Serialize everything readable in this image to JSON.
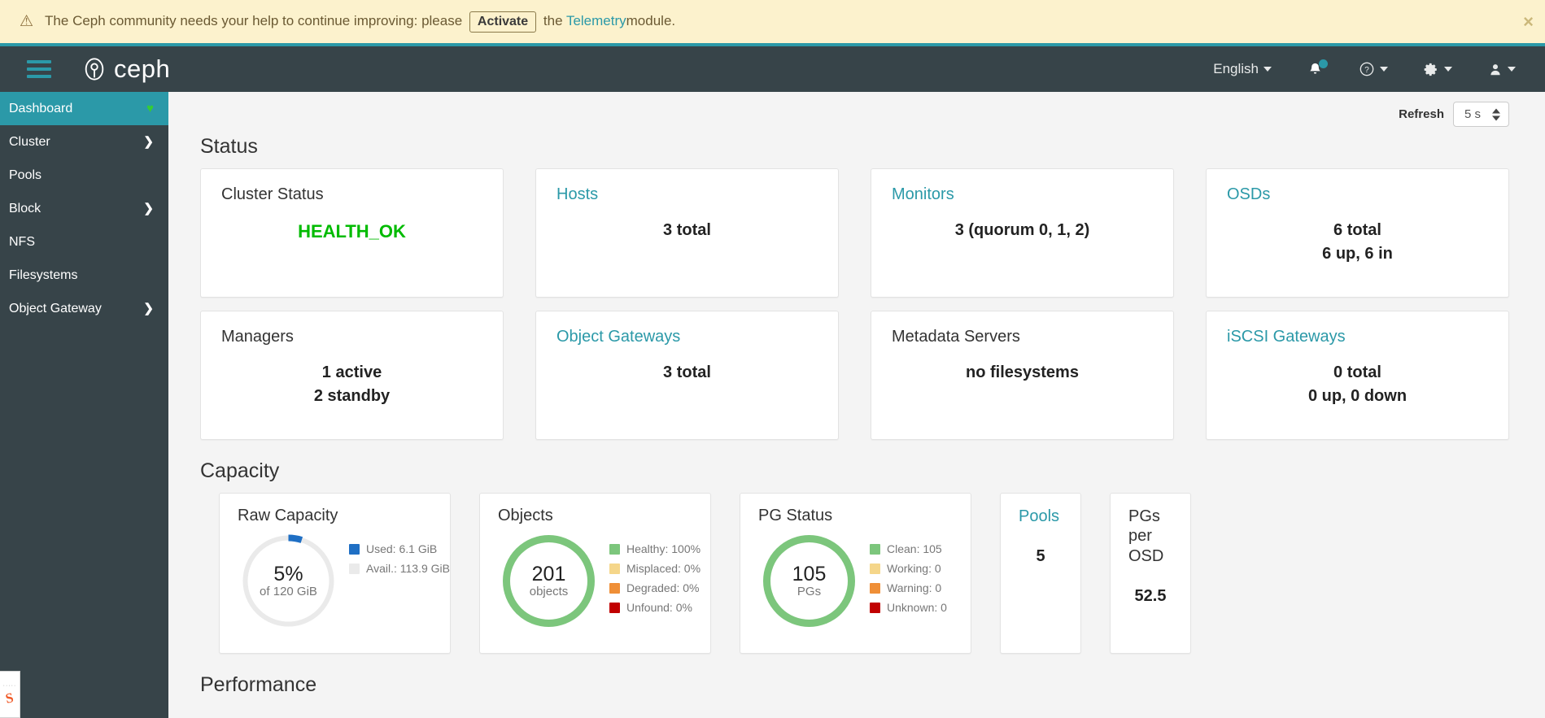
{
  "banner": {
    "warn_icon": "warning-triangle-icon",
    "text_before": "The Ceph community needs your help to continue improving: please",
    "activate_label": "Activate",
    "text_middle": "the",
    "link_label": "Telemetry",
    "text_after": "module.",
    "close_label": "×"
  },
  "navbar": {
    "brand": "ceph",
    "language": "English",
    "items": [
      "language-selector",
      "notifications",
      "help",
      "settings",
      "user"
    ]
  },
  "sidebar": {
    "items": [
      {
        "label": "Dashboard",
        "active": true,
        "chevron": "",
        "heart": "♥"
      },
      {
        "label": "Cluster",
        "active": false,
        "chevron": "❯"
      },
      {
        "label": "Pools",
        "active": false,
        "chevron": ""
      },
      {
        "label": "Block",
        "active": false,
        "chevron": "❯"
      },
      {
        "label": "NFS",
        "active": false,
        "chevron": ""
      },
      {
        "label": "Filesystems",
        "active": false,
        "chevron": ""
      },
      {
        "label": "Object Gateway",
        "active": false,
        "chevron": "❯"
      }
    ]
  },
  "toolbar": {
    "refresh_label": "Refresh",
    "refresh_value": "5 s"
  },
  "sections": {
    "status_title": "Status",
    "capacity_title": "Capacity",
    "performance_title": "Performance"
  },
  "status_cards": [
    {
      "title": "Cluster Status",
      "is_link": false,
      "lines": [
        "HEALTH_OK"
      ],
      "state": "ok"
    },
    {
      "title": "Hosts",
      "is_link": true,
      "lines": [
        "3 total"
      ]
    },
    {
      "title": "Monitors",
      "is_link": true,
      "lines": [
        "3 (quorum 0, 1, 2)"
      ]
    },
    {
      "title": "OSDs",
      "is_link": true,
      "lines": [
        "6 total",
        "6 up, 6 in"
      ]
    },
    {
      "title": "Managers",
      "is_link": false,
      "lines": [
        "1 active",
        "2 standby"
      ]
    },
    {
      "title": "Object Gateways",
      "is_link": true,
      "lines": [
        "3 total"
      ]
    },
    {
      "title": "Metadata Servers",
      "is_link": false,
      "lines": [
        "no filesystems"
      ]
    },
    {
      "title": "iSCSI Gateways",
      "is_link": true,
      "lines": [
        "0 total",
        "0 up, 0 down"
      ]
    }
  ],
  "capacity": {
    "raw": {
      "title": "Raw Capacity",
      "center_big": "5%",
      "center_sub": "of 120 GiB",
      "legend": [
        {
          "label": "Used: 6.1 GiB",
          "color": "#1f6fc4"
        },
        {
          "label": "Avail.: 113.9 GiB",
          "color": "#eaeaea"
        }
      ]
    },
    "objects": {
      "title": "Objects",
      "center_big": "201",
      "center_sub": "objects",
      "legend": [
        {
          "label": "Healthy: 100%",
          "color": "#7cc67c"
        },
        {
          "label": "Misplaced: 0%",
          "color": "#f5d68a"
        },
        {
          "label": "Degraded: 0%",
          "color": "#ef8f37"
        },
        {
          "label": "Unfound: 0%",
          "color": "#c10000"
        }
      ]
    },
    "pg_status": {
      "title": "PG Status",
      "center_big": "105",
      "center_sub": "PGs",
      "legend": [
        {
          "label": "Clean: 105",
          "color": "#7cc67c"
        },
        {
          "label": "Working: 0",
          "color": "#f5d68a"
        },
        {
          "label": "Warning: 0",
          "color": "#ef8f37"
        },
        {
          "label": "Unknown: 0",
          "color": "#c10000"
        }
      ]
    },
    "pools": {
      "title": "Pools",
      "is_link": true,
      "value": "5"
    },
    "pgs_per_osd": {
      "title": "PGs per OSD",
      "is_link": false,
      "value": "52.5"
    }
  },
  "chart_data": [
    {
      "type": "pie",
      "title": "Raw Capacity",
      "labels": [
        "Used",
        "Avail."
      ],
      "values": [
        6.1,
        113.9
      ],
      "unit": "GiB",
      "total": 120,
      "used_percent": 5,
      "colors": [
        "#1f6fc4",
        "#eaeaea"
      ],
      "legend": "right"
    },
    {
      "type": "pie",
      "title": "Objects",
      "labels": [
        "Healthy",
        "Misplaced",
        "Degraded",
        "Unfound"
      ],
      "values": [
        100,
        0,
        0,
        0
      ],
      "unit": "%",
      "total": 201,
      "total_label": "objects",
      "colors": [
        "#7cc67c",
        "#f5d68a",
        "#ef8f37",
        "#c10000"
      ],
      "legend": "right"
    },
    {
      "type": "pie",
      "title": "PG Status",
      "labels": [
        "Clean",
        "Working",
        "Warning",
        "Unknown"
      ],
      "values": [
        105,
        0,
        0,
        0
      ],
      "unit": "PGs",
      "total": 105,
      "total_label": "PGs",
      "colors": [
        "#7cc67c",
        "#f5d68a",
        "#ef8f37",
        "#c10000"
      ],
      "legend": "right"
    }
  ]
}
